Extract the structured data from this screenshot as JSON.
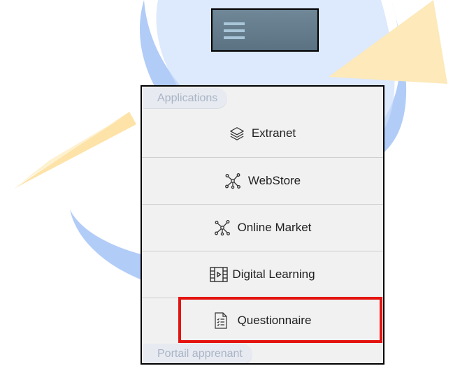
{
  "menu_button": {
    "icon": "hamburger-icon"
  },
  "menu": {
    "section_label": "Applications",
    "items": [
      {
        "label": "Extranet",
        "icon": "layers-icon"
      },
      {
        "label": "WebStore",
        "icon": "network-icon"
      },
      {
        "label": "Online Market",
        "icon": "network-icon"
      },
      {
        "label": "Digital Learning",
        "icon": "video-film-icon"
      },
      {
        "label": "Questionnaire",
        "icon": "checklist-document-icon",
        "highlighted": true
      }
    ],
    "next_section_label": "Portail apprenant"
  },
  "colors": {
    "watermark_blue": "#8fb4f5",
    "watermark_orange": "#fde7b6",
    "highlight": "#e41410",
    "section_label_text": "#a9b4c6",
    "menu_button_bg": "#6a8292"
  }
}
